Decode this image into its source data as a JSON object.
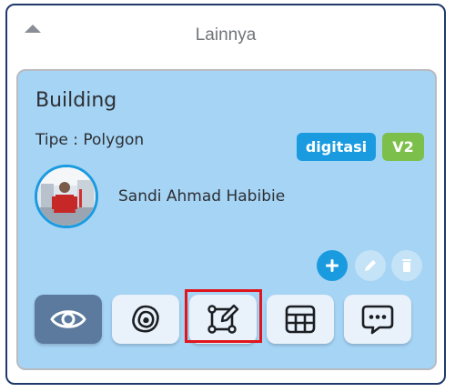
{
  "panel": {
    "title": "Lainnya",
    "collapse_icon": "chevron-up-icon"
  },
  "card": {
    "title": "Building",
    "type_text": "Tipe : Polygon",
    "badges": {
      "digitasi": "digitasi",
      "version": "V2"
    },
    "user": {
      "name": "Sandi Ahmad Habibie",
      "avatar_icon": "user-avatar"
    },
    "actions": [
      {
        "name": "add-button",
        "icon": "plus-icon",
        "enabled": true
      },
      {
        "name": "edit-button",
        "icon": "pencil-icon",
        "enabled": false
      },
      {
        "name": "delete-button",
        "icon": "trash-icon",
        "enabled": false
      }
    ],
    "tools": [
      {
        "name": "view-tool",
        "icon": "eye-icon",
        "active": true
      },
      {
        "name": "layer-tool",
        "icon": "layers-icon",
        "active": false
      },
      {
        "name": "digitize-tool",
        "icon": "edit-polygon-icon",
        "active": false,
        "highlighted": true
      },
      {
        "name": "table-tool",
        "icon": "table-icon",
        "active": false
      },
      {
        "name": "comment-tool",
        "icon": "chat-bubble-icon",
        "active": false
      }
    ]
  },
  "colors": {
    "card_background": "#a6d4f5",
    "accent_blue": "#1a9be0",
    "version_green": "#7cc04b",
    "active_tool": "#5c7a9e",
    "highlight_red": "#e0161c",
    "panel_border": "#1f3a6b"
  }
}
